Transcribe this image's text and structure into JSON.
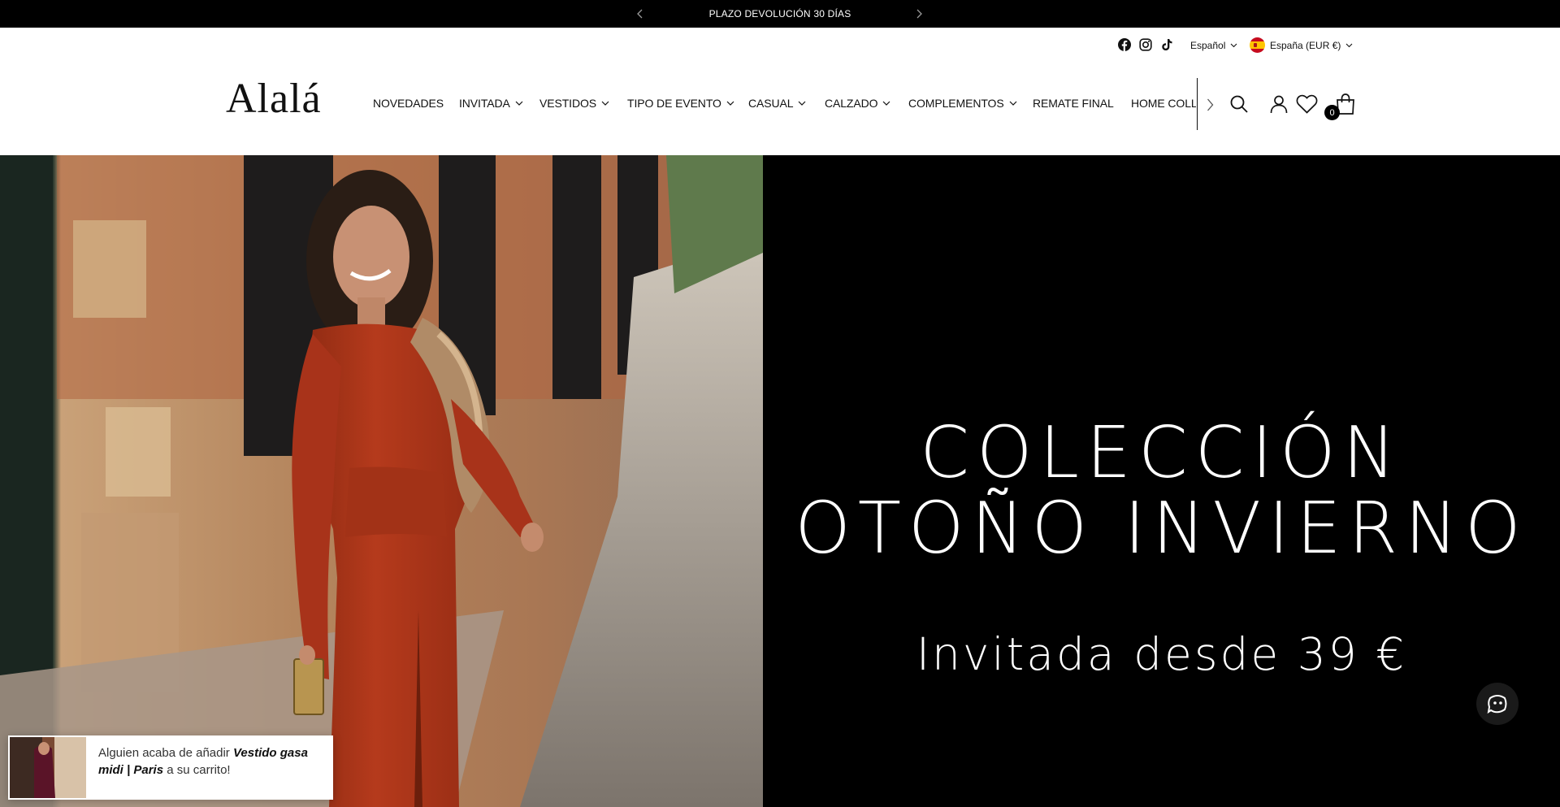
{
  "announcement": {
    "text": "PLAZO DEVOLUCIÓN 30 DÍAS",
    "prev_icon": "chevron-left-icon",
    "next_icon": "chevron-right-icon"
  },
  "utility": {
    "social": [
      "facebook-icon",
      "instagram-icon",
      "tiktok-icon"
    ],
    "language": "Español",
    "country": "España (EUR €)"
  },
  "header": {
    "logo": "Alalá",
    "nav": [
      {
        "label": "NOVEDADES",
        "dropdown": false
      },
      {
        "label": "INVITADA",
        "dropdown": true
      },
      {
        "label": "VESTIDOS",
        "dropdown": true
      },
      {
        "label": "TIPO DE EVENTO",
        "dropdown": true
      },
      {
        "label": "CASUAL",
        "dropdown": true
      },
      {
        "label": "CALZADO",
        "dropdown": true
      },
      {
        "label": "COMPLEMENTOS",
        "dropdown": true
      },
      {
        "label": "REMATE FINAL",
        "dropdown": false
      },
      {
        "label": "HOME COLLE",
        "dropdown": false
      }
    ],
    "icons": [
      "search-icon",
      "account-icon",
      "wishlist-heart-icon",
      "cart-bag-icon"
    ],
    "cart_count": "0"
  },
  "hero": {
    "title_line1": "COLECCIÓN",
    "title_line2": "OTOÑO INVIERNO",
    "subtitle": "Invitada desde 39 €",
    "background": "#000000",
    "dress_color": "#b53a1c"
  },
  "notification": {
    "prefix": "Alguien acaba de añadir ",
    "product": "Vestido gasa midi | Paris",
    "suffix": " a su carrito!"
  },
  "chat": {
    "icon": "chat-bot-icon"
  }
}
